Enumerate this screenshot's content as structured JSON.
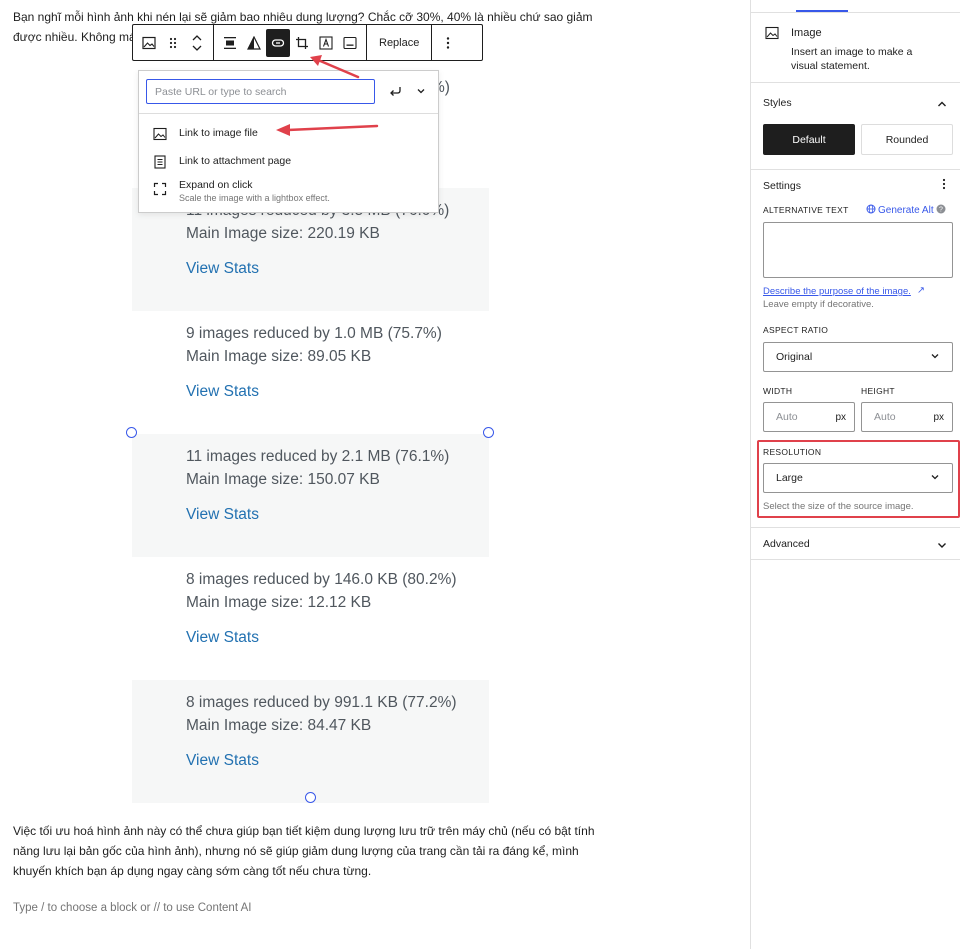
{
  "editor": {
    "paragraph_top": "Bạn nghĩ mỗi hình ảnh khi nén lại sẽ giảm bao nhiêu dung lượng? Chắc cỡ 30%, 40% là nhiều chứ sao giảm được nhiều. Không má ơi, giảm đến 7",
    "paragraph_bottom": "Việc tối ưu hoá hình ảnh này có thể chưa giúp bạn tiết kiệm dung lượng lưu trữ trên máy chủ (nếu có bật tính năng lưu lại bản gốc của hình ảnh), nhưng nó sẽ giúp giảm dung lượng của trang cần tải ra đáng kể, mình khuyến khích bạn áp dụng ngay càng sớm càng tốt nếu chưa từng.",
    "placeholder": "Type / to choose a block or // to use Content AI",
    "peek_text": "%)",
    "stats": [
      {
        "line1": "11 images reduced by 3.5 MB (76.0%)",
        "line2": "Main Image size: 220.19 KB",
        "link": "View Stats"
      },
      {
        "line1": "9 images reduced by 1.0 MB (75.7%)",
        "line2": "Main Image size: 89.05 KB",
        "link": "View Stats"
      },
      {
        "line1": "11 images reduced by 2.1 MB (76.1%)",
        "line2": "Main Image size: 150.07 KB",
        "link": "View Stats"
      },
      {
        "line1": "8 images reduced by 146.0 KB (80.2%)",
        "line2": "Main Image size: 12.12 KB",
        "link": "View Stats"
      },
      {
        "line1": "8 images reduced by 991.1 KB (77.2%)",
        "line2": "Main Image size: 84.47 KB",
        "link": "View Stats"
      }
    ]
  },
  "toolbar": {
    "icons": [
      "image-icon",
      "drag-handle-icon",
      "move-up-down-icon",
      "align-icon",
      "duotone-icon",
      "link-icon",
      "crop-icon",
      "text-overlay-icon",
      "caption-icon",
      "more-options-icon"
    ],
    "replace_label": "Replace"
  },
  "link_popover": {
    "placeholder": "Paste URL or type to search",
    "items": [
      {
        "label": "Link to image file",
        "icon": "image-icon"
      },
      {
        "label": "Link to attachment page",
        "icon": "page-icon"
      },
      {
        "label": "Expand on click",
        "sublabel": "Scale the image with a lightbox effect.",
        "icon": "fullscreen-icon"
      }
    ]
  },
  "sidebar": {
    "block_card": {
      "title": "Image",
      "description": "Insert an image to make a visual statement."
    },
    "styles": {
      "title": "Styles",
      "options": [
        "Default",
        "Rounded"
      ],
      "selected": "Default"
    },
    "settings": {
      "title": "Settings",
      "alt_text_label": "ALTERNATIVE TEXT",
      "generate_alt": "Generate Alt",
      "alt_value": "",
      "describe_link": "Describe the purpose of the image.",
      "alt_help": "Leave empty if decorative.",
      "aspect_ratio_label": "ASPECT RATIO",
      "aspect_ratio_value": "Original",
      "width_label": "WIDTH",
      "height_label": "HEIGHT",
      "width_placeholder": "Auto",
      "height_placeholder": "Auto",
      "unit": "px",
      "resolution_label": "RESOLUTION",
      "resolution_value": "Large",
      "resolution_help": "Select the size of the source image."
    },
    "advanced": {
      "title": "Advanced"
    }
  },
  "colors": {
    "accent": "#3858e9",
    "annotation_red": "#e0414b",
    "link": "#2271b1",
    "stat_text": "#50575e",
    "stat_bg": "#f6f7f7"
  }
}
